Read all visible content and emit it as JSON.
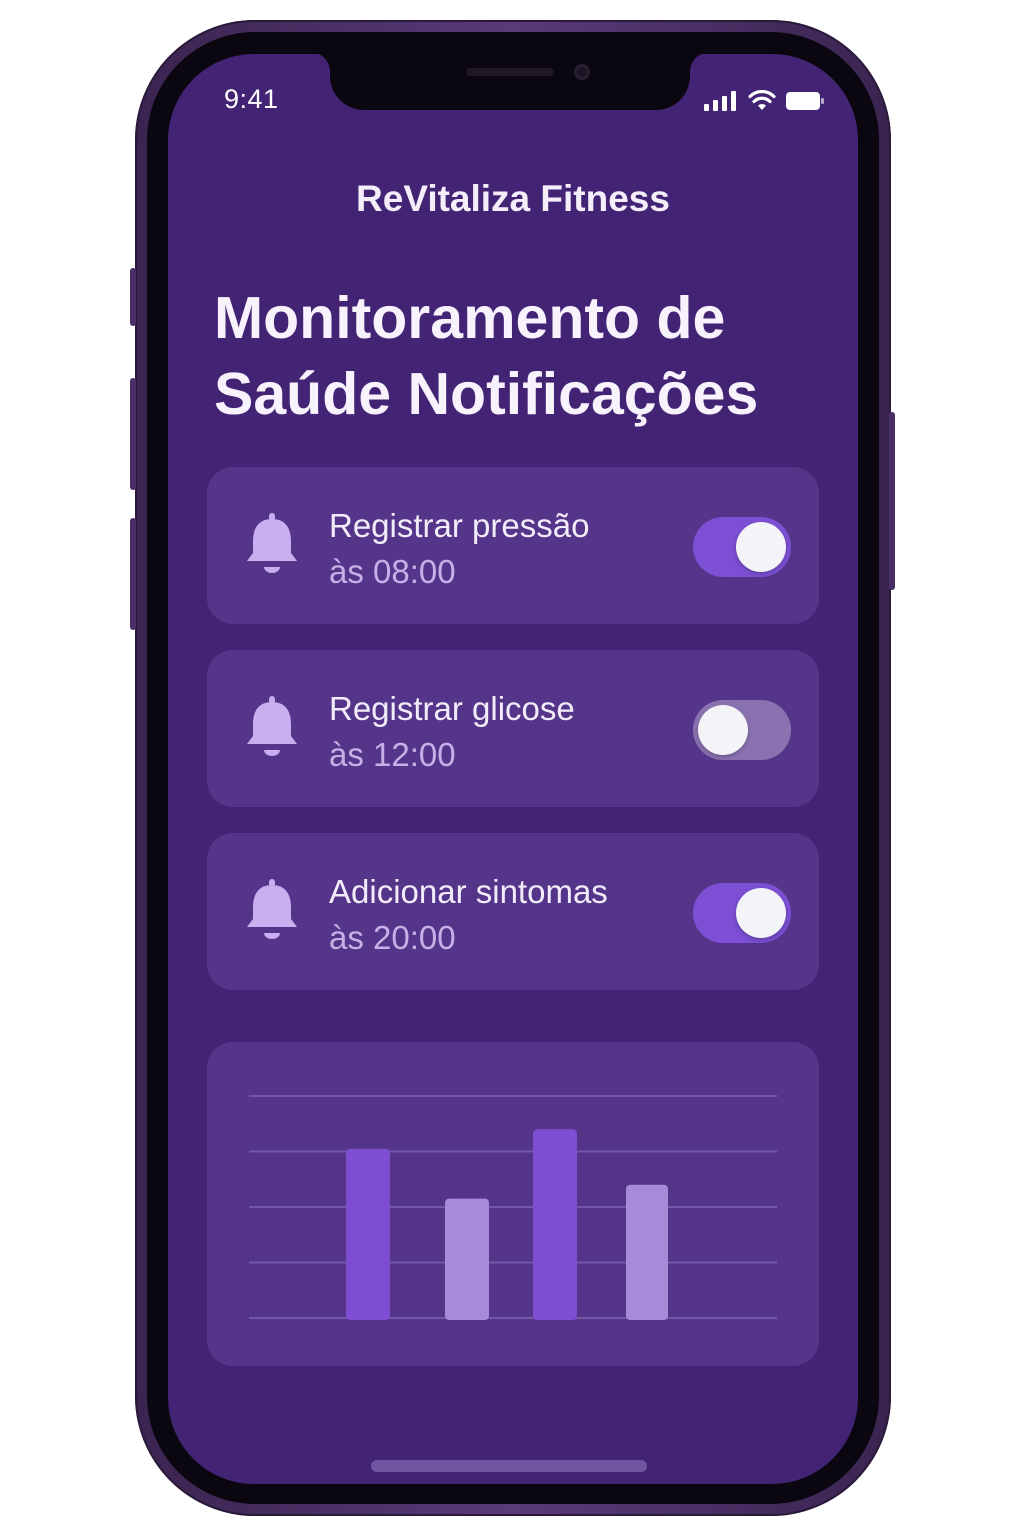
{
  "status_bar": {
    "time": "9:41",
    "icons": [
      "cellular-signal-icon",
      "wifi-icon",
      "battery-icon"
    ]
  },
  "header": {
    "app_title": "ReVitaliza Fitness"
  },
  "page": {
    "title": "Monitoramento de Saúde Notificações"
  },
  "notifications": [
    {
      "title": "Registrar pressão",
      "time": "às 08:00",
      "enabled": true,
      "icon": "bell-icon"
    },
    {
      "title": "Registrar glicose",
      "time": "às 12:00",
      "enabled": false,
      "icon": "bell-icon"
    },
    {
      "title": "Adicionar sintomas",
      "time": "às 20:00",
      "enabled": true,
      "icon": "bell-icon"
    }
  ],
  "colors": {
    "screen_bg": "#432374",
    "card_bg": "#553589",
    "accent": "#7c4fd4",
    "toggle_off": "#8a72b0",
    "bar_dark": "#7d4ed2",
    "bar_light": "#a78ad8",
    "bell": "#c9aef0",
    "subtitle": "#c6b0e8"
  },
  "chart_data": {
    "type": "bar",
    "categories": [
      "",
      "",
      "",
      ""
    ],
    "values": [
      3.05,
      2.15,
      3.4,
      2.4
    ],
    "ylim": [
      0,
      4
    ],
    "grid": true,
    "bar_colors": [
      "#7d4ed2",
      "#a78ad8",
      "#7d4ed2",
      "#a78ad8"
    ]
  }
}
